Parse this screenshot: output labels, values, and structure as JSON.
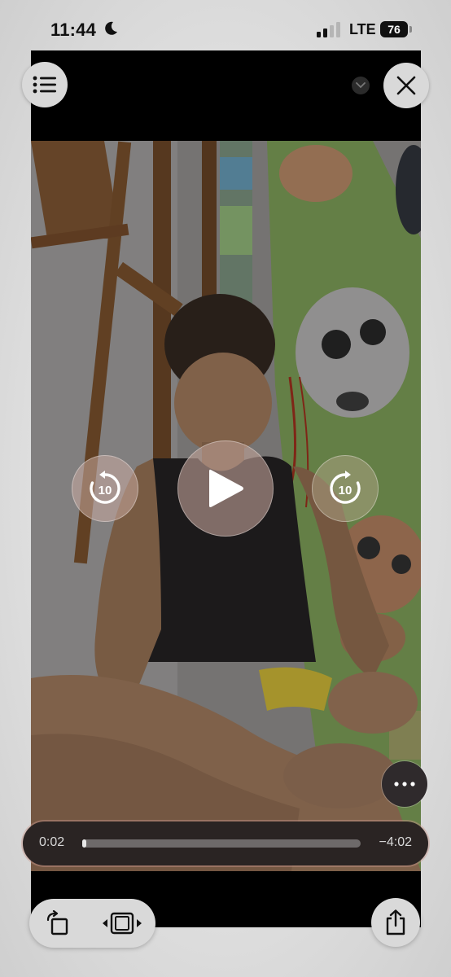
{
  "status_bar": {
    "time": "11:44",
    "network": "LTE",
    "battery": "76"
  },
  "player": {
    "elapsed": "0:02",
    "remaining": "−4:02",
    "progress_fraction": 0.008,
    "skip_back_seconds": "10",
    "skip_forward_seconds": "10"
  },
  "icons": {
    "menu": "list-icon",
    "close": "close-icon",
    "chevron": "chevron-down-icon",
    "skip_back": "skip-back-10-icon",
    "play": "play-icon",
    "skip_forward": "skip-forward-10-icon",
    "more": "ellipsis-icon",
    "rotate": "rotate-icon",
    "fit": "aspect-fit-icon",
    "share": "share-icon"
  }
}
